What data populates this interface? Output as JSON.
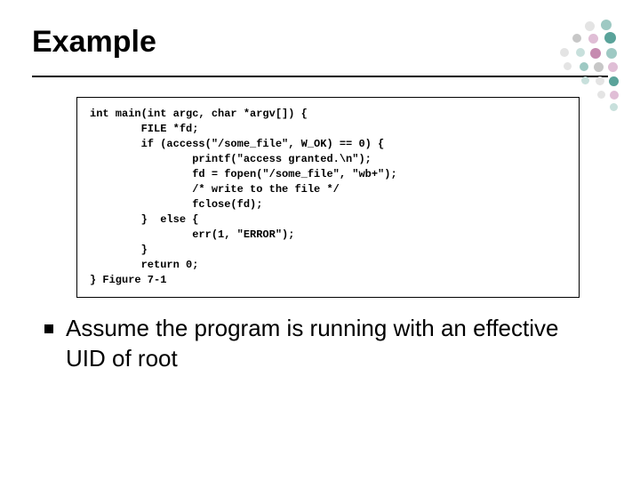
{
  "title": "Example",
  "code": {
    "l0": "int main(int argc, char *argv[]) {",
    "l1": "        FILE *fd;",
    "l2": "        if (access(\"/some_file\", W_OK) == 0) {",
    "l3": "                printf(\"access granted.\\n\");",
    "l4": "                fd = fopen(\"/some_file\", \"wb+\");",
    "l5": "                /* write to the file */",
    "l6": "                fclose(fd);",
    "l7": "        }  else {",
    "l8": "                err(1, \"ERROR\");",
    "l9": "        }",
    "l10": "        return 0;",
    "l11": "} Figure 7-1"
  },
  "bullet": "Assume the program is running with an effective UID of root"
}
